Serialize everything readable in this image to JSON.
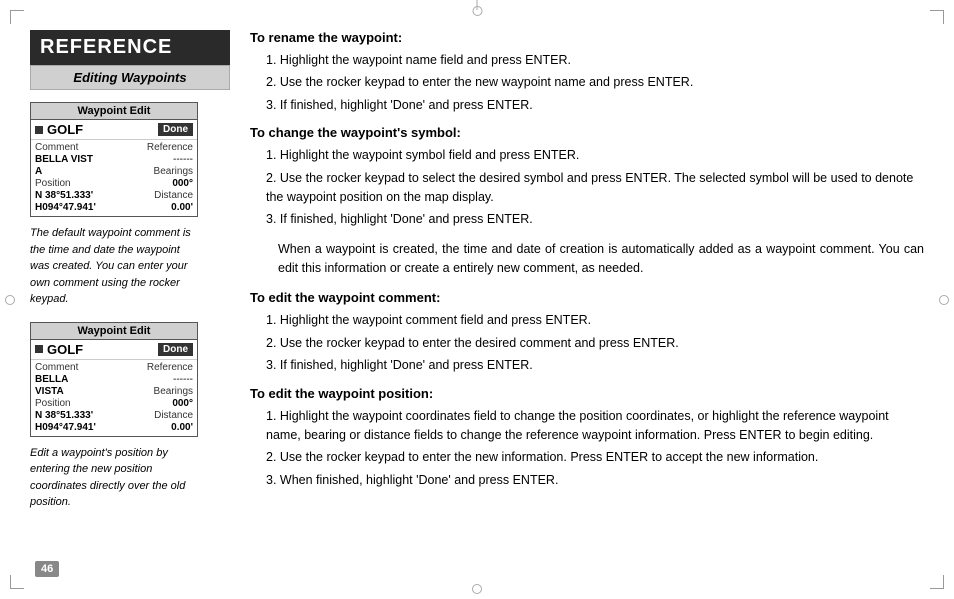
{
  "page": {
    "title": "REFERENCE",
    "subtitle": "Editing Waypoints",
    "page_number": "46"
  },
  "waypoint_box_1": {
    "title": "Waypoint Edit",
    "golf_label": "GOLF",
    "done_label": "Done",
    "rows": [
      {
        "label": "Comment",
        "value": "Reference"
      },
      {
        "label": "BELLA VIST",
        "value": "------"
      },
      {
        "label": "A",
        "value": "Bearings"
      },
      {
        "label": "Position",
        "value": "000°"
      },
      {
        "label": "N 38°51.333'",
        "value": "Distance"
      },
      {
        "label": "H094°47.941'",
        "value": "0.00'"
      }
    ]
  },
  "waypoint_box_2": {
    "title": "Waypoint Edit",
    "golf_label": "GOLF",
    "done_label": "Done",
    "rows": [
      {
        "label": "Comment",
        "value": "Reference"
      },
      {
        "label": "BELLA",
        "value": "------"
      },
      {
        "label": "VISTA",
        "value": "Bearings"
      },
      {
        "label": "Position",
        "value": "000°"
      },
      {
        "label": "N 38°51.333'",
        "value": "Distance"
      },
      {
        "label": "H094°47.941'",
        "value": "0.00'"
      }
    ]
  },
  "caption_1": "The default waypoint comment is the time and date the waypoint was created. You can enter your own comment using the rocker keypad.",
  "caption_2": "Edit a waypoint's position by entering the new position coordinates directly over the old position.",
  "sections": [
    {
      "id": "rename",
      "title": "To rename the waypoint:",
      "steps": [
        "1. Highlight the waypoint name field and press ENTER.",
        "2. Use the rocker keypad to enter the new waypoint name and press ENTER.",
        "3. If finished, highlight 'Done' and press ENTER."
      ]
    },
    {
      "id": "symbol",
      "title": "To change the waypoint's symbol:",
      "steps": [
        "1. Highlight the waypoint symbol field and press ENTER.",
        "2. Use the rocker keypad to select the desired symbol and press ENTER. The selected symbol will be used to denote the waypoint position on the map display.",
        "3. If finished, highlight 'Done' and press ENTER."
      ]
    },
    {
      "id": "comment-intro",
      "paragraph": "When a waypoint is created, the time and date of creation is automatically added as a waypoint comment. You can edit this information or create a entirely new comment, as needed."
    },
    {
      "id": "edit-comment",
      "title": "To edit the waypoint comment:",
      "steps": [
        "1. Highlight the waypoint comment field and press ENTER.",
        "2. Use the rocker keypad to enter the desired comment and press ENTER.",
        "3. If finished, highlight 'Done' and press ENTER."
      ]
    },
    {
      "id": "edit-position",
      "title": "To edit the waypoint position:",
      "steps": [
        "1. Highlight the waypoint coordinates field to change the position coordinates, or highlight the reference waypoint name, bearing or distance fields to change the reference waypoint information. Press ENTER to begin editing.",
        "2. Use the rocker keypad to enter the new information. Press ENTER to accept the new information.",
        "3. When finished, highlight 'Done' and press ENTER."
      ]
    }
  ]
}
